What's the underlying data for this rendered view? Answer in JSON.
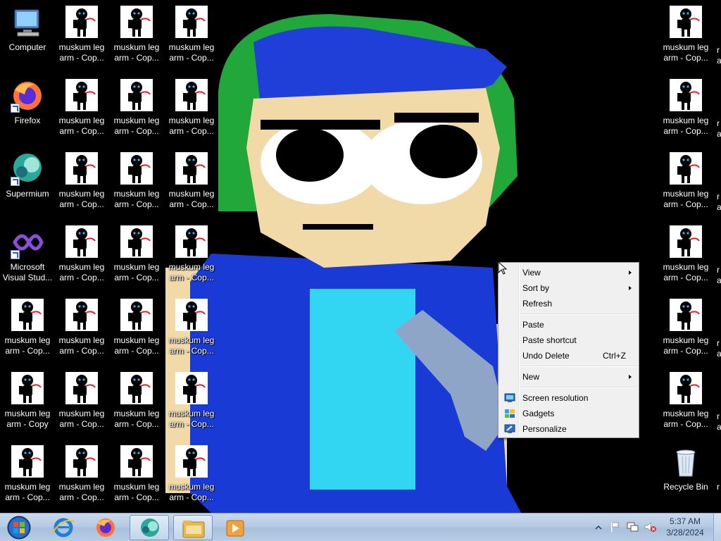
{
  "desktop": {
    "left_icons": [
      {
        "label": "Computer",
        "icon": "computer-icon",
        "shortcut": false
      },
      {
        "label": "Firefox",
        "icon": "firefox-icon",
        "shortcut": true
      },
      {
        "label": "Supermium",
        "icon": "supermium-icon",
        "shortcut": true
      },
      {
        "label": "Microsoft\nVisual Stud...",
        "icon": "visual-studio-icon",
        "shortcut": true
      }
    ],
    "meme_label_prefix": "muskum leg",
    "meme_labels": {
      "col1_row5": "muskum leg\narm - Cop...",
      "col1_row6": "muskum leg\narm - Copy",
      "col1_row7": "muskum leg\narm - Cop...",
      "default": "muskum leg\narm - Cop..."
    },
    "right_edge_label": "r\na",
    "recycle_bin": {
      "label": "Recycle Bin",
      "icon": "recycle-bin-icon"
    }
  },
  "context_menu": {
    "items": [
      {
        "label": "View",
        "submenu": true
      },
      {
        "label": "Sort by",
        "submenu": true
      },
      {
        "label": "Refresh"
      },
      {
        "label": "Paste"
      },
      {
        "label": "Paste shortcut"
      },
      {
        "label": "Undo Delete",
        "shortcut": "Ctrl+Z"
      },
      {
        "label": "New",
        "submenu": true
      },
      {
        "label": "Screen resolution",
        "icon": "screen-resolution-icon"
      },
      {
        "label": "Gadgets",
        "icon": "gadgets-icon"
      },
      {
        "label": "Personalize",
        "icon": "personalize-icon"
      }
    ]
  },
  "taskbar": {
    "start": "start-orb-icon",
    "pinned": [
      "internet-explorer-icon",
      "firefox-icon",
      "supermium-icon",
      "file-explorer-icon",
      "media-player-icon"
    ],
    "tray": {
      "time": "5:37 AM",
      "date": "3/28/2024",
      "icons": [
        "show-hidden-icons-icon",
        "action-center-flag-icon",
        "network-icon",
        "volume-muted-icon"
      ]
    }
  },
  "colors": {
    "taskbar": "#b6cbe3",
    "menu_bg": "#f0f0f0",
    "wallpaper_bg": "#000000"
  }
}
